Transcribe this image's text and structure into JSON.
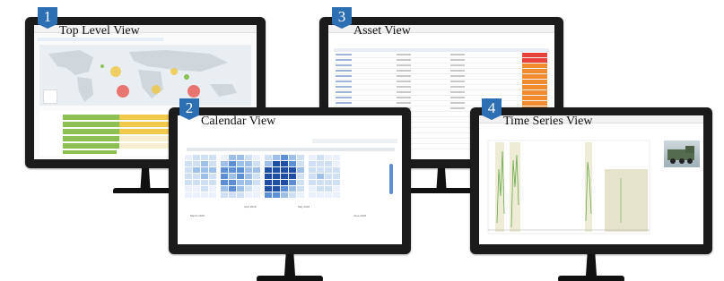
{
  "views": [
    {
      "number": "1",
      "title": "Top Level View"
    },
    {
      "number": "2",
      "title": "Calendar View"
    },
    {
      "number": "3",
      "title": "Asset View"
    },
    {
      "number": "4",
      "title": "Time Series View"
    }
  ],
  "calendar_view": {
    "months": [
      "March 2018",
      "April 2018",
      "May 2018",
      "June 2018"
    ]
  },
  "colors": {
    "bezel": "#1b1b1b",
    "badge": "#2d6fb3",
    "heatmap_dark": "#1f4fa3",
    "heatmap_light": "#cfe0f4",
    "status_green": "#8cc152",
    "status_yellow": "#f0c84a",
    "status_red": "#e8413a",
    "status_orange": "#f28a2e"
  }
}
